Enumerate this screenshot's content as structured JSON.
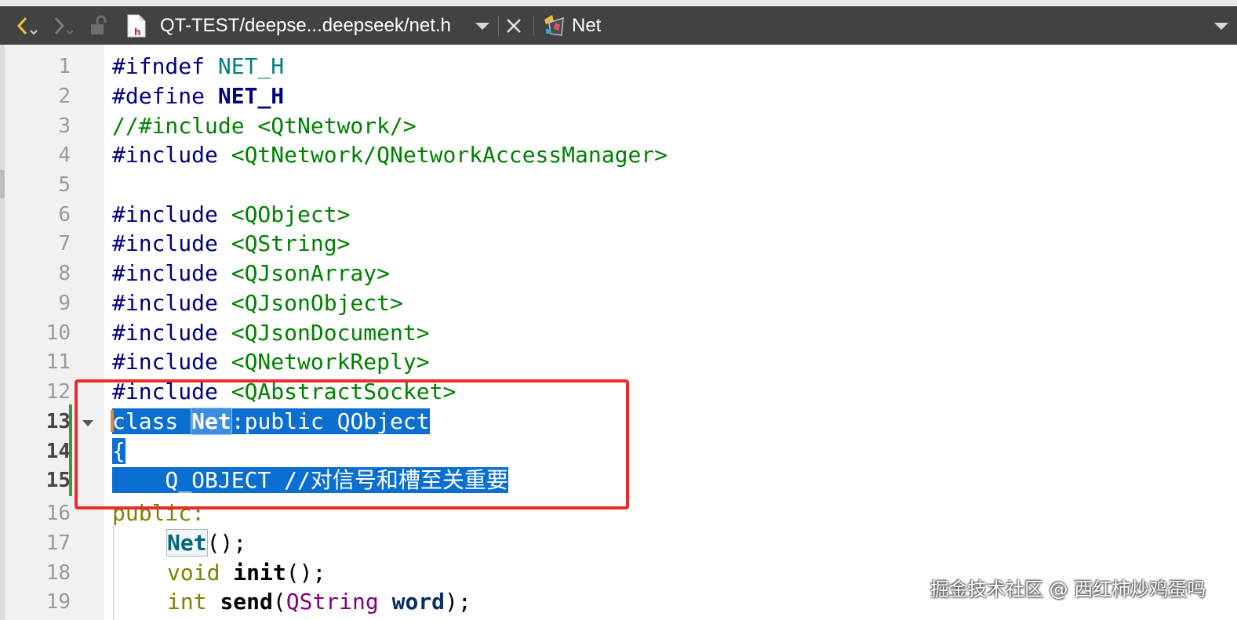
{
  "toolbar": {
    "file_path": "QT-TEST/deepse...deepseek/net.h",
    "class_name": "Net",
    "icons": [
      "back-icon",
      "forward-icon",
      "lock-icon",
      "header-file-icon",
      "dropdown-icon",
      "close-icon",
      "class-icon",
      "menu-dropdown-icon"
    ]
  },
  "editor": {
    "lines": [
      "1",
      "2",
      "3",
      "4",
      "5",
      "6",
      "7",
      "8",
      "9",
      "10",
      "11",
      "12",
      "13",
      "14",
      "15",
      "16",
      "17",
      "18",
      "19"
    ],
    "current_lines": [
      "13",
      "14",
      "15"
    ],
    "code": {
      "l1_kw": "#ifndef",
      "l1_mac": "NET_H",
      "l2_kw": "#define",
      "l2_mac": "NET_H",
      "l3": "//#include <QtNetwork/>",
      "l4_kw": "#include",
      "l4_inc": "<QtNetwork/QNetworkAccessManager>",
      "l6_kw": "#include",
      "l6_inc": "<QObject>",
      "l7_kw": "#include",
      "l7_inc": "<QString>",
      "l8_kw": "#include",
      "l8_inc": "<QJsonArray>",
      "l9_kw": "#include",
      "l9_inc": "<QJsonObject>",
      "l10_kw": "#include",
      "l10_inc": "<QJsonDocument>",
      "l11_kw": "#include",
      "l11_inc": "<QNetworkReply>",
      "l12_kw": "#include",
      "l12_inc": "<QAbstractSocket>",
      "l13_a": "class ",
      "l13_b": "Net",
      "l13_c": ":public QObject",
      "l14": "{",
      "l15": "    Q_OBJECT //对信号和槽至关重要",
      "l16": "public:",
      "l17_a": "Net",
      "l17_b": "();",
      "l18_a": "void ",
      "l18_b": "init",
      "l18_c": "();",
      "l19_a": "int ",
      "l19_b": "send",
      "l19_c": "(",
      "l19_d": "QString",
      "l19_e": " ",
      "l19_f": "word",
      "l19_g": ");"
    }
  },
  "colors": {
    "toolbar_bg": "#404244",
    "gutter_bg": "#f1f1f1",
    "selection": "#0a6fd0",
    "highlight_box": "#ee2b2b",
    "string_green": "#008000",
    "macro_teal": "#008080",
    "keyword_olive": "#808000"
  },
  "watermark": "掘金技术社区 @ 西红柿炒鸡蛋吗"
}
